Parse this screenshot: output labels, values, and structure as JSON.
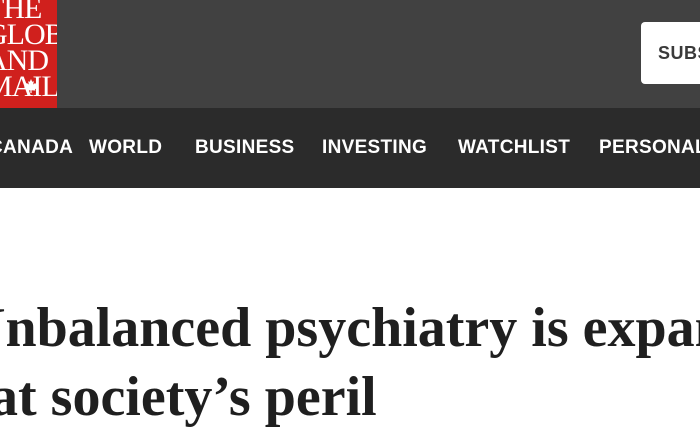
{
  "header": {
    "logo_lines": [
      "THE",
      "GLOBE",
      "AND",
      "MAIL"
    ],
    "logo_icon": "maple-leaf-icon",
    "subscribe_label": "SUBSCRIBE",
    "colors": {
      "topbar": "#414141",
      "logo_bg": "#d0201d",
      "navbar": "#2b2b2b"
    }
  },
  "nav": {
    "items": [
      "CANADA",
      "WORLD",
      "BUSINESS",
      "INVESTING",
      "WATCHLIST",
      "PERSONAL FINANCE"
    ]
  },
  "article": {
    "headline_line1": "Unbalanced psychiatry is expanding",
    "headline_line2": "at society’s peril"
  }
}
